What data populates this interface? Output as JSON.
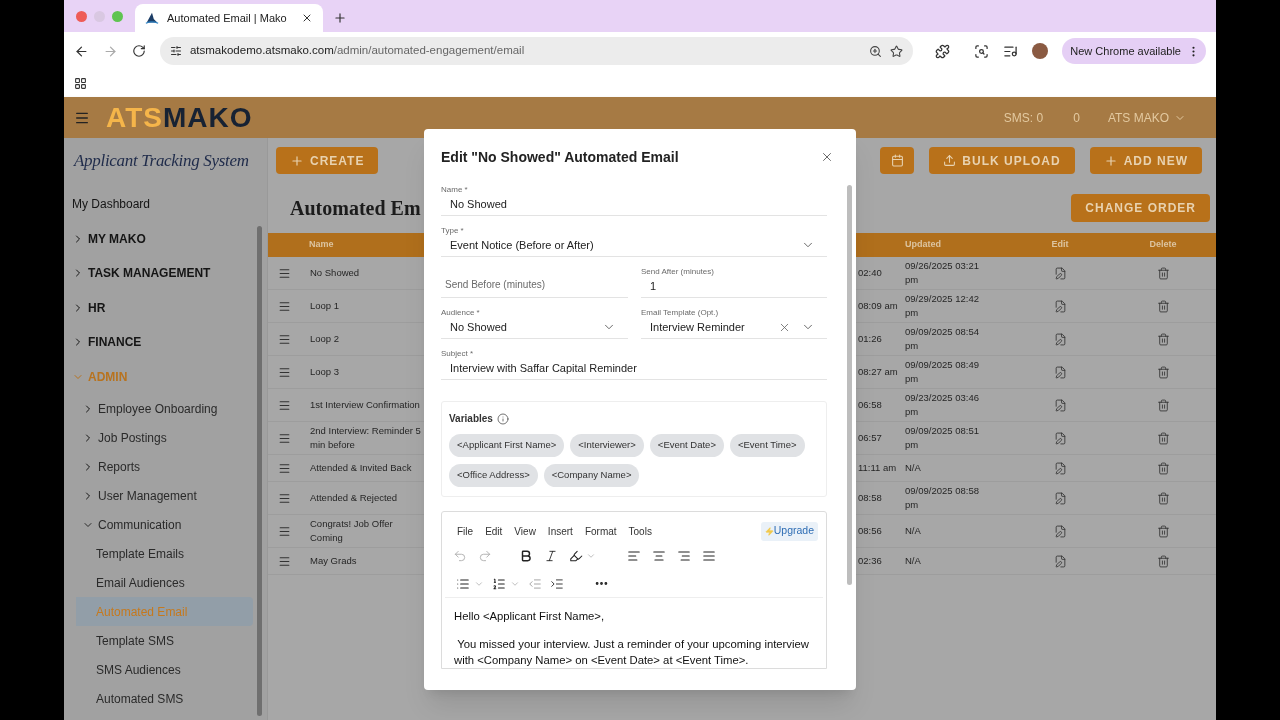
{
  "browser": {
    "tab_title": "Automated Email | Mako",
    "url_host": "atsmakodemo.atsmako.com",
    "url_path": "/admin/automated-engagement/email",
    "update_label": "New Chrome available"
  },
  "header": {
    "logo_left": "ATS",
    "logo_right": "MAKO",
    "sms": "SMS: 0",
    "count": "0",
    "user": "ATS MAKO"
  },
  "sidebar": {
    "subtitle": "Applicant Tracking System",
    "items": [
      {
        "label": "My Dashboard",
        "kind": "link",
        "selected": false
      },
      {
        "label": "MY MAKO",
        "kind": "section",
        "expanded": false
      },
      {
        "label": "TASK MANAGEMENT",
        "kind": "section",
        "expanded": false
      },
      {
        "label": "HR",
        "kind": "section",
        "expanded": false
      },
      {
        "label": "FINANCE",
        "kind": "section",
        "expanded": false
      },
      {
        "label": "ADMIN",
        "kind": "section",
        "expanded": true,
        "children": [
          {
            "label": "Employee Onboarding",
            "kind": "group",
            "expanded": false
          },
          {
            "label": "Job Postings",
            "kind": "group",
            "expanded": false
          },
          {
            "label": "Reports",
            "kind": "group",
            "expanded": false
          },
          {
            "label": "User Management",
            "kind": "group",
            "expanded": false
          },
          {
            "label": "Communication",
            "kind": "group",
            "expanded": true,
            "children": [
              {
                "label": "Template Emails",
                "kind": "link",
                "selected": false
              },
              {
                "label": "Email Audiences",
                "kind": "link",
                "selected": false
              },
              {
                "label": "Automated Email",
                "kind": "link",
                "selected": true
              },
              {
                "label": "Template SMS",
                "kind": "link",
                "selected": false
              },
              {
                "label": "SMS Audiences",
                "kind": "link",
                "selected": false
              },
              {
                "label": "Automated SMS",
                "kind": "link",
                "selected": false
              }
            ]
          }
        ]
      }
    ]
  },
  "toolbar": {
    "create": "CREATE",
    "bulk_upload": "BULK UPLOAD",
    "add_new": "ADD NEW"
  },
  "page_title": "Automated Em",
  "change_order": "CHANGE ORDER",
  "table": {
    "columns": {
      "name": "Name",
      "updated": "Updated",
      "edit": "Edit",
      "delete": "Delete"
    },
    "rows": [
      {
        "name": "No Showed",
        "column_3": "02:40",
        "updated": "09/26/2025 03:21 pm"
      },
      {
        "name": "Loop 1",
        "column_3": "08:09 am",
        "updated": "09/29/2025 12:42 pm"
      },
      {
        "name": "Loop 2",
        "column_3": "01:26",
        "updated": "09/09/2025 08:54 pm"
      },
      {
        "name": "Loop 3",
        "column_3": "08:27 am",
        "updated": "09/09/2025 08:49 pm"
      },
      {
        "name": "1st Interview Confirmation",
        "column_3": "06:58",
        "updated": "09/23/2025 03:46 pm"
      },
      {
        "name": "2nd Interview: Reminder 5 min before",
        "column_3": "06:57",
        "updated": "09/09/2025 08:51 pm"
      },
      {
        "name": "Attended & Invited Back",
        "column_3": "11:11 am",
        "updated": "N/A"
      },
      {
        "name": "Attended & Rejected",
        "column_3": "08:58",
        "updated": "09/09/2025 08:58 pm"
      },
      {
        "name": "Congrats! Job Offer Coming",
        "column_3": "08:56",
        "updated": "N/A"
      },
      {
        "name": "May Grads",
        "column_3": "02:36",
        "updated": "N/A"
      }
    ]
  },
  "modal": {
    "title": "Edit \"No Showed\" Automated Email",
    "name": {
      "label": "Name *",
      "value": "No Showed"
    },
    "type": {
      "label": "Type *",
      "value": "Event Notice (Before or After)"
    },
    "send_before": {
      "placeholder": "Send Before (minutes)"
    },
    "send_after": {
      "label": "Send After (minutes)",
      "value": "1"
    },
    "audience": {
      "label": "Audience *",
      "value": "No Showed"
    },
    "email_template": {
      "label": "Email Template (Opt.)",
      "value": "Interview Reminder"
    },
    "subject": {
      "label": "Subject *",
      "value": "Interview with Saffar Capital Reminder"
    },
    "variables": {
      "title": "Variables",
      "chips": [
        "<Applicant First Name>",
        "<Interviewer>",
        "<Event Date>",
        "<Event Time>",
        "<Office Address>",
        "<Company Name>"
      ]
    },
    "editor": {
      "menus": [
        "File",
        "Edit",
        "View",
        "Insert",
        "Format",
        "Tools"
      ],
      "upgrade": "Upgrade",
      "body": [
        "Hello <Applicant First Name>,",
        " You missed your interview. Just a reminder of your upcoming interview with <Company Name> on <Event Date> at <Event Time>."
      ]
    }
  }
}
